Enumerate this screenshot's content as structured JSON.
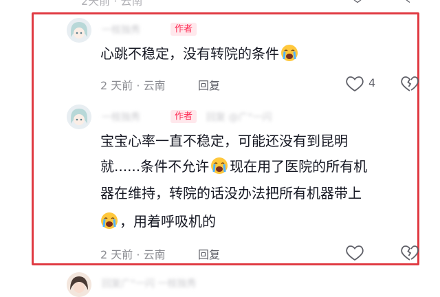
{
  "prev_comment": {
    "meta_partial": "2天前 · 云南"
  },
  "comment1": {
    "username": "一枝独秀",
    "author_badge": "作者",
    "text": "心跳不稳定，没有转院的条件",
    "emoji": "loudly-crying-face",
    "time": "2 天前",
    "location": "云南",
    "separator": "·",
    "reply_label": "回复",
    "likes": "4"
  },
  "comment2": {
    "username": "一枝独秀",
    "author_badge": "作者",
    "reply_target": "回复 @广°一闪 ",
    "lines": [
      "宝宝心率一直不稳定，可能还没有到昆明",
      "就......条件不允许",
      "现在用了医院的所有机",
      "器在维持，转院的话没办法把所有机器带上",
      "，用着呼吸机的"
    ],
    "time": "2 天前",
    "location": "云南",
    "separator": "·",
    "reply_label": "回复"
  },
  "next_comment": {
    "username": "回复广°一闪 一枝独秀"
  },
  "colors": {
    "highlight_border": "#e03a42",
    "author_badge": "#fe2c55",
    "meta": "#8a8b91"
  }
}
